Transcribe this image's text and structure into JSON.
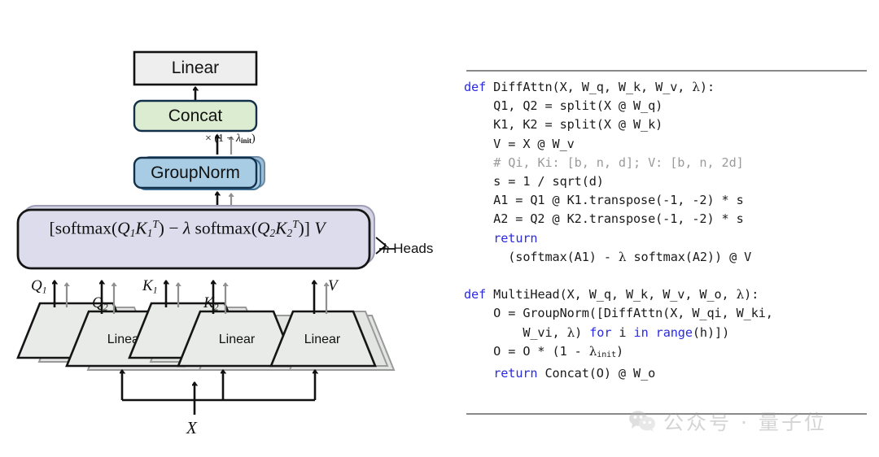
{
  "diagram": {
    "title_blocks": {
      "linear_top": "Linear",
      "concat": "Concat",
      "groupnorm": "GroupNorm"
    },
    "scale_annotation": "× (1 − λinit)",
    "heads_annotation": "h Heads",
    "formula": "[softmax(Q1K1T) − λ softmax(Q2K2T)] V",
    "projection_labels": {
      "q1": "Q1",
      "q2": "Q2",
      "k1": "K1",
      "k2": "K2",
      "v": "V"
    },
    "linear_q": "Linear",
    "linear_k": "Linear",
    "linear_v": "Linear",
    "input_label": "X",
    "colors": {
      "linear_box_fill": "#eeeeee",
      "concat_fill": "#dcecd0",
      "groupnorm_fill": "#a8cce4",
      "formula_fill": "#dcdcec",
      "trapezoid_fill": "#e9ebe9",
      "shadow": "#9a9a9a",
      "stroke": "#151515"
    }
  },
  "code": {
    "lines": [
      "def DiffAttn(X, W_q, W_k, W_v, λ):",
      "    Q1, Q2 = split(X @ W_q)",
      "    K1, K2 = split(X @ W_k)",
      "    V = X @ W_v",
      "    # Qi, Ki: [b, n, d]; V: [b, n, 2d]",
      "    s = 1 / sqrt(d)",
      "    A1 = Q1 @ K1.transpose(-1, -2) * s",
      "    A2 = Q2 @ K2.transpose(-1, -2) * s",
      "    return",
      "      (softmax(A1) - λ softmax(A2)) @ V",
      "",
      "def MultiHead(X, W_q, W_k, W_v, W_o, λ):",
      "    O = GroupNorm([DiffAttn(X, W_qi, W_ki,",
      "         W_vi, λ) for i in range(h)])",
      "    O = O * (1 - λinit)",
      "    return Concat(O) @ W_o"
    ],
    "keywords": [
      "def",
      "return",
      "for",
      "in",
      "range"
    ],
    "comment": "# Qi, Ki: [b, n, d]; V: [b, n, 2d]",
    "keyword_color": "#2a2ae0",
    "comment_color": "#9a9a9a"
  },
  "watermark": {
    "text": "公众号 · 量子位",
    "icon": "wechat-icon",
    "color": "#9b9b9b"
  }
}
